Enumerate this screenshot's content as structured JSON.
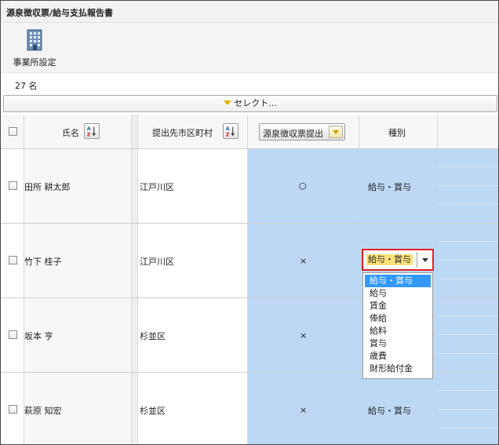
{
  "window": {
    "title": "源泉徴収票/給与支払報告書"
  },
  "toolbar": {
    "office_settings_label": "事業所設定"
  },
  "summary": {
    "count_label": "27 名"
  },
  "select_bar": {
    "label": "セレクト..."
  },
  "table": {
    "headers": {
      "name": "氏名",
      "municipality": "提出先市区町村",
      "withholding_submit": "源泉徴収票提出",
      "category": "種別"
    },
    "rows": [
      {
        "name": "田所 耕太郎",
        "municipality": "江戸川区",
        "submit": "○",
        "category": "給与・賞与"
      },
      {
        "name": "竹下 桂子",
        "municipality": "江戸川区",
        "submit": "×",
        "category": ""
      },
      {
        "name": "坂本 亨",
        "municipality": "杉並区",
        "submit": "×",
        "category": ""
      },
      {
        "name": "萩原 知宏",
        "municipality": "杉並区",
        "submit": "×",
        "category": "給与・賞与"
      }
    ]
  },
  "category_combo": {
    "value": "給与・賞与",
    "options": [
      "給与・賞与",
      "給与",
      "賃金",
      "俸給",
      "給料",
      "賞与",
      "歳費",
      "財形給付金"
    ]
  },
  "colors": {
    "highlight_column": "#bcd8f4",
    "combo_border": "#e32020",
    "selected_option": "#3399ff"
  }
}
